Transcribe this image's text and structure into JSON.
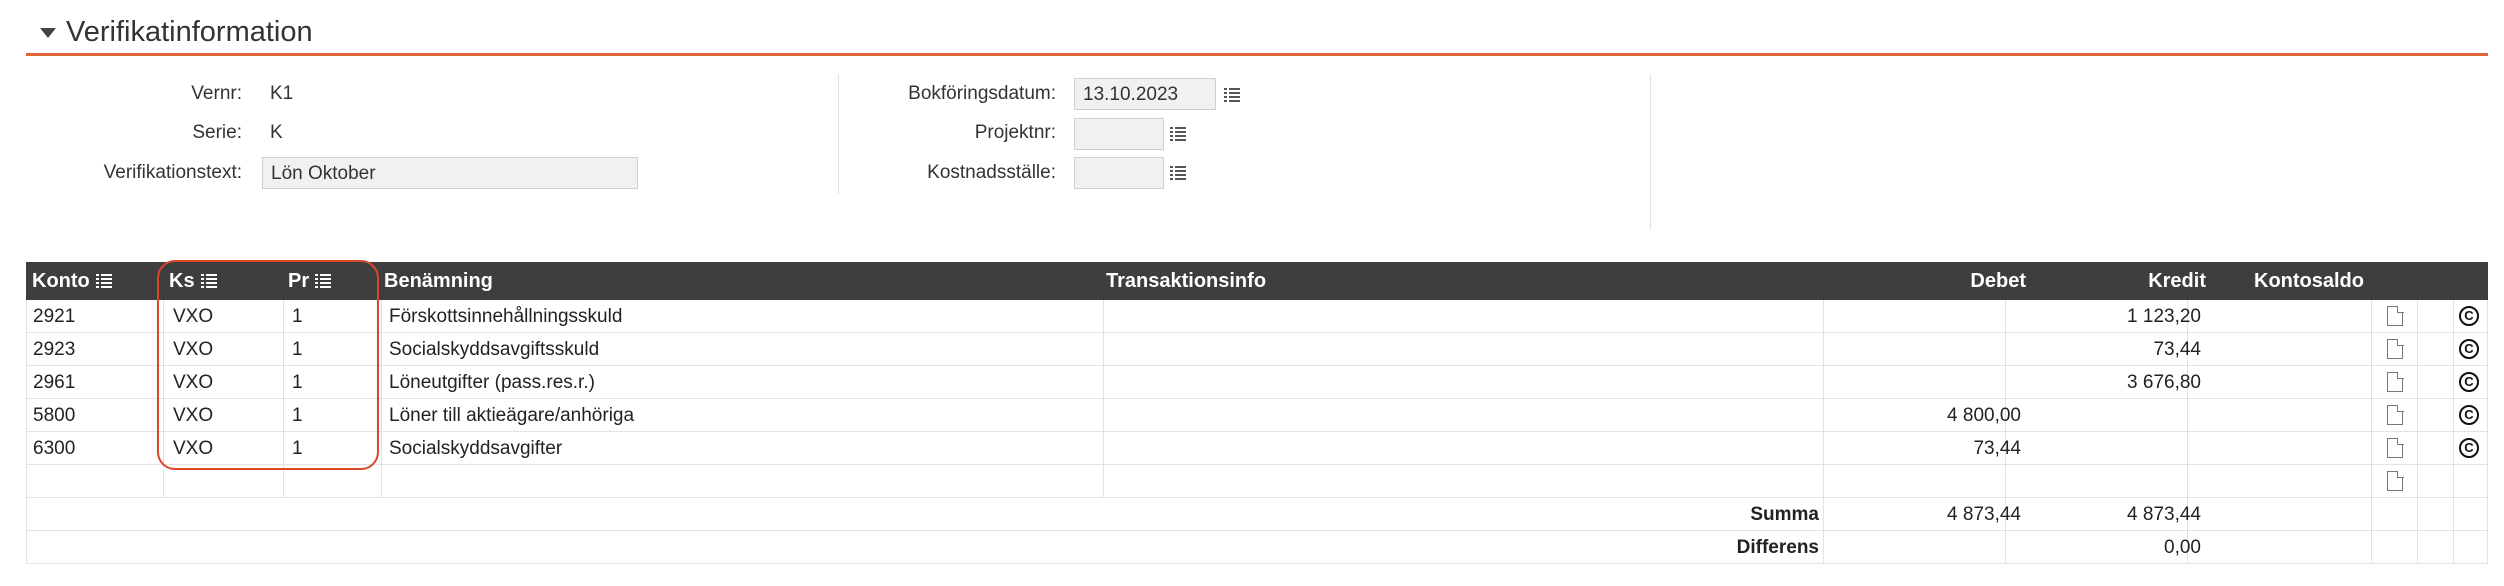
{
  "section": {
    "title": "Verifikatinformation"
  },
  "form": {
    "vernr_label": "Vernr:",
    "vernr_value": "K1",
    "serie_label": "Serie:",
    "serie_value": "K",
    "text_label": "Verifikationstext:",
    "text_value": "Lön Oktober",
    "date_label": "Bokföringsdatum:",
    "date_value": "13.10.2023",
    "projekt_label": "Projektnr:",
    "projekt_value": "",
    "kostnad_label": "Kostnadsställe:",
    "kostnad_value": ""
  },
  "table": {
    "headers": {
      "konto": "Konto",
      "ks": "Ks",
      "pr": "Pr",
      "benamning": "Benämning",
      "transinfo": "Transaktionsinfo",
      "debet": "Debet",
      "kredit": "Kredit",
      "kontosaldo": "Kontosaldo"
    },
    "rows": [
      {
        "konto": "2921",
        "ks": "VXO",
        "pr": "1",
        "benamning": "Förskottsinnehållningsskuld",
        "transinfo": "",
        "debet": "",
        "kredit": "1 123,20",
        "kontosaldo": ""
      },
      {
        "konto": "2923",
        "ks": "VXO",
        "pr": "1",
        "benamning": "Socialskyddsavgiftsskuld",
        "transinfo": "",
        "debet": "",
        "kredit": "73,44",
        "kontosaldo": ""
      },
      {
        "konto": "2961",
        "ks": "VXO",
        "pr": "1",
        "benamning": "Löneutgifter (pass.res.r.)",
        "transinfo": "",
        "debet": "",
        "kredit": "3 676,80",
        "kontosaldo": ""
      },
      {
        "konto": "5800",
        "ks": "VXO",
        "pr": "1",
        "benamning": "Löner till aktieägare/anhöriga",
        "transinfo": "",
        "debet": "4 800,00",
        "kredit": "",
        "kontosaldo": ""
      },
      {
        "konto": "6300",
        "ks": "VXO",
        "pr": "1",
        "benamning": "Socialskyddsavgifter",
        "transinfo": "",
        "debet": "73,44",
        "kredit": "",
        "kontosaldo": ""
      }
    ],
    "summa": {
      "label": "Summa",
      "debet": "4 873,44",
      "kredit": "4 873,44"
    },
    "differens": {
      "label": "Differens",
      "kredit": "0,00"
    }
  },
  "icons": {
    "list": "list-icon",
    "document": "document-icon",
    "copy": "copyright-icon"
  },
  "colors": {
    "accent": "#e0663a",
    "header_bg": "#3e3e3e",
    "highlight": "#d9482b"
  }
}
